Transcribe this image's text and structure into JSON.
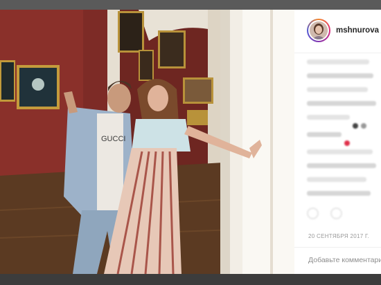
{
  "post": {
    "username": "mshnurova",
    "separator": "•",
    "date": "20 СЕНТЯБРЯ 2017 Г.",
    "comment_placeholder": "Добавьте комментарий..."
  },
  "shirt_text": "GUCCI",
  "colors": {
    "wall": "#7a2a24",
    "floor": "#5a3a24",
    "panel_bg": "#ffffff",
    "username": "#262626",
    "date": "#999999",
    "placeholder": "#8e8e8e"
  }
}
